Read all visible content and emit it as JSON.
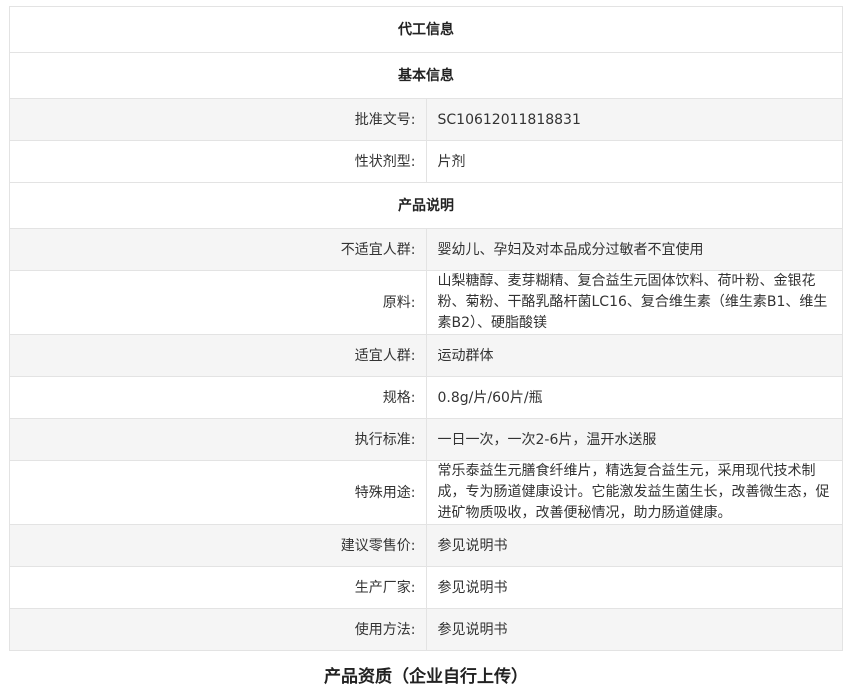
{
  "sections": {
    "oem_title": "代工信息",
    "basic_title": "基本信息",
    "product_title": "产品说明"
  },
  "basic": {
    "approval_label": "批准文号:",
    "approval_value": "SC10612011818831",
    "form_label": "性状剂型:",
    "form_value": "片剂"
  },
  "product": {
    "unsuitable_label": "不适宜人群:",
    "unsuitable_value": "婴幼儿、孕妇及对本品成分过敏者不宜使用",
    "ingredients_label": "原料:",
    "ingredients_value": "山梨糖醇、麦芽糊精、复合益生元固体饮料、荷叶粉、金银花粉、菊粉、干酪乳酪杆菌LC16、复合维生素（维生素B1、维生素B2）、硬脂酸镁",
    "suitable_label": "适宜人群:",
    "suitable_value": "运动群体",
    "spec_label": "规格:",
    "spec_value": "0.8g/片/60片/瓶",
    "standard_label": "执行标准:",
    "standard_value": "一日一次，一次2-6片，温开水送服",
    "special_label": "特殊用途:",
    "special_value": "常乐泰益生元膳食纤维片，精选复合益生元，采用现代技术制成，专为肠道健康设计。它能激发益生菌生长，改善微生态，促进矿物质吸收，改善便秘情况，助力肠道健康。",
    "price_label": "建议零售价:",
    "price_value": "参见说明书",
    "maker_label": "生产厂家:",
    "maker_value": "参见说明书",
    "usage_label": "使用方法:",
    "usage_value": "参见说明书"
  },
  "footer": {
    "qualification_title": "产品资质（企业自行上传）"
  }
}
